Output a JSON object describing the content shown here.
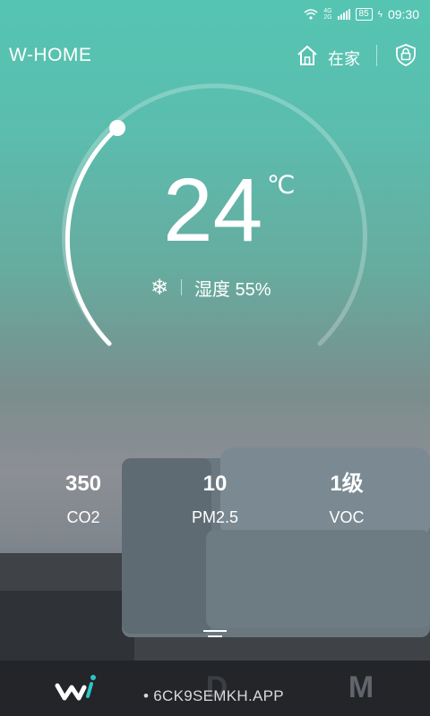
{
  "status_bar": {
    "network_top": "4G",
    "network_bottom": "2G",
    "battery": "85",
    "time": "09:30"
  },
  "header": {
    "brand": "W-HOME",
    "home_label": "在家",
    "home_icon": "home-icon",
    "lock_icon": "shield-lock-icon"
  },
  "thermostat": {
    "temperature": "24",
    "unit": "℃",
    "mode_icon": "snowflake-icon",
    "mode_glyph": "❄",
    "humidity_text": "湿度 55%",
    "dial_progress": 0.05
  },
  "metrics": [
    {
      "value": "350",
      "label": "CO2"
    },
    {
      "value": "10",
      "label": "PM2.5"
    },
    {
      "value": "1级",
      "label": "VOC"
    }
  ],
  "nav": {
    "tab2": "D",
    "tab3": "M"
  },
  "watermark": "• 6CK9SEMKH.APP",
  "colors": {
    "accent": "#55c5b2",
    "nav_bg": "#232529",
    "logo_teal": "#2ec4c4"
  }
}
